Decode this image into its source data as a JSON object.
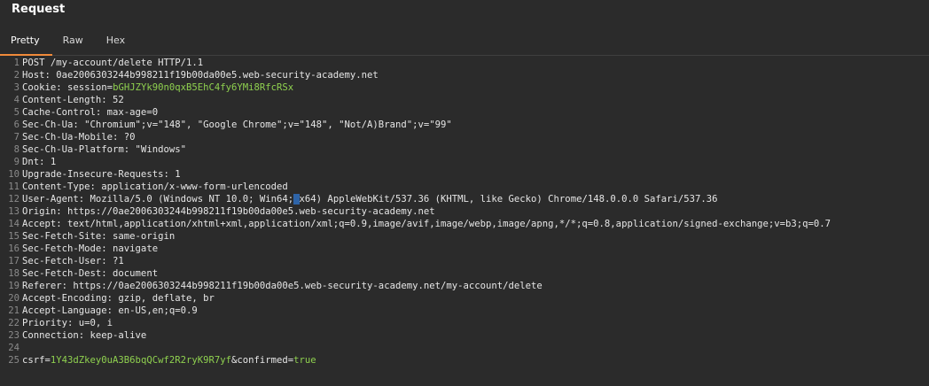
{
  "panel": {
    "title": "Request",
    "tabs": [
      {
        "label": "Pretty",
        "active": true
      },
      {
        "label": "Raw",
        "active": false
      },
      {
        "label": "Hex",
        "active": false
      }
    ]
  },
  "editor": {
    "lines": [
      {
        "n": "1",
        "text": "POST /my-account/delete HTTP/1.1"
      },
      {
        "n": "2",
        "text": "Host: 0ae2006303244b998211f19b00da00e5.web-security-academy.net"
      },
      {
        "n": "3",
        "name": "Cookie",
        "pre": "session=",
        "green": "bGHJZYk90n0qxB5EhC4fy6YMi8RfcRSx",
        "post": ""
      },
      {
        "n": "4",
        "text": "Content-Length: 52"
      },
      {
        "n": "5",
        "text": "Cache-Control: max-age=0"
      },
      {
        "n": "6",
        "text": "Sec-Ch-Ua: \"Chromium\";v=\"148\", \"Google Chrome\";v=\"148\", \"Not/A)Brand\";v=\"99\""
      },
      {
        "n": "7",
        "text": "Sec-Ch-Ua-Mobile: ?0"
      },
      {
        "n": "8",
        "text": "Sec-Ch-Ua-Platform: \"Windows\""
      },
      {
        "n": "9",
        "text": "Dnt: 1"
      },
      {
        "n": "10",
        "text": "Upgrade-Insecure-Requests: 1"
      },
      {
        "n": "11",
        "text": "Content-Type: application/x-www-form-urlencoded"
      },
      {
        "n": "12",
        "pre": "User-Agent: Mozilla/5.0 (Windows NT 10.0; Win64;",
        "sel": " ",
        "post": "x64) AppleWebKit/537.36 (KHTML, like Gecko) Chrome/148.0.0.0 Safari/537.36"
      },
      {
        "n": "13",
        "text": "Origin: https://0ae2006303244b998211f19b00da00e5.web-security-academy.net"
      },
      {
        "n": "14",
        "text": "Accept: text/html,application/xhtml+xml,application/xml;q=0.9,image/avif,image/webp,image/apng,*/*;q=0.8,application/signed-exchange;v=b3;q=0.7"
      },
      {
        "n": "15",
        "text": "Sec-Fetch-Site: same-origin"
      },
      {
        "n": "16",
        "text": "Sec-Fetch-Mode: navigate"
      },
      {
        "n": "17",
        "text": "Sec-Fetch-User: ?1"
      },
      {
        "n": "18",
        "text": "Sec-Fetch-Dest: document"
      },
      {
        "n": "19",
        "text": "Referer: https://0ae2006303244b998211f19b00da00e5.web-security-academy.net/my-account/delete"
      },
      {
        "n": "20",
        "text": "Accept-Encoding: gzip, deflate, br"
      },
      {
        "n": "21",
        "text": "Accept-Language: en-US,en;q=0.9"
      },
      {
        "n": "22",
        "text": "Priority: u=0, i"
      },
      {
        "n": "23",
        "text": "Connection: keep-alive"
      },
      {
        "n": "24",
        "text": ""
      },
      {
        "n": "25",
        "body": [
          {
            "t": "csrf=",
            "c": "plain"
          },
          {
            "t": "1Y43dZkey0uA3B6bqQCwf2R2ryK9R7yf",
            "c": "green"
          },
          {
            "t": "&confirmed=",
            "c": "plain"
          },
          {
            "t": "true",
            "c": "green"
          }
        ]
      }
    ]
  }
}
